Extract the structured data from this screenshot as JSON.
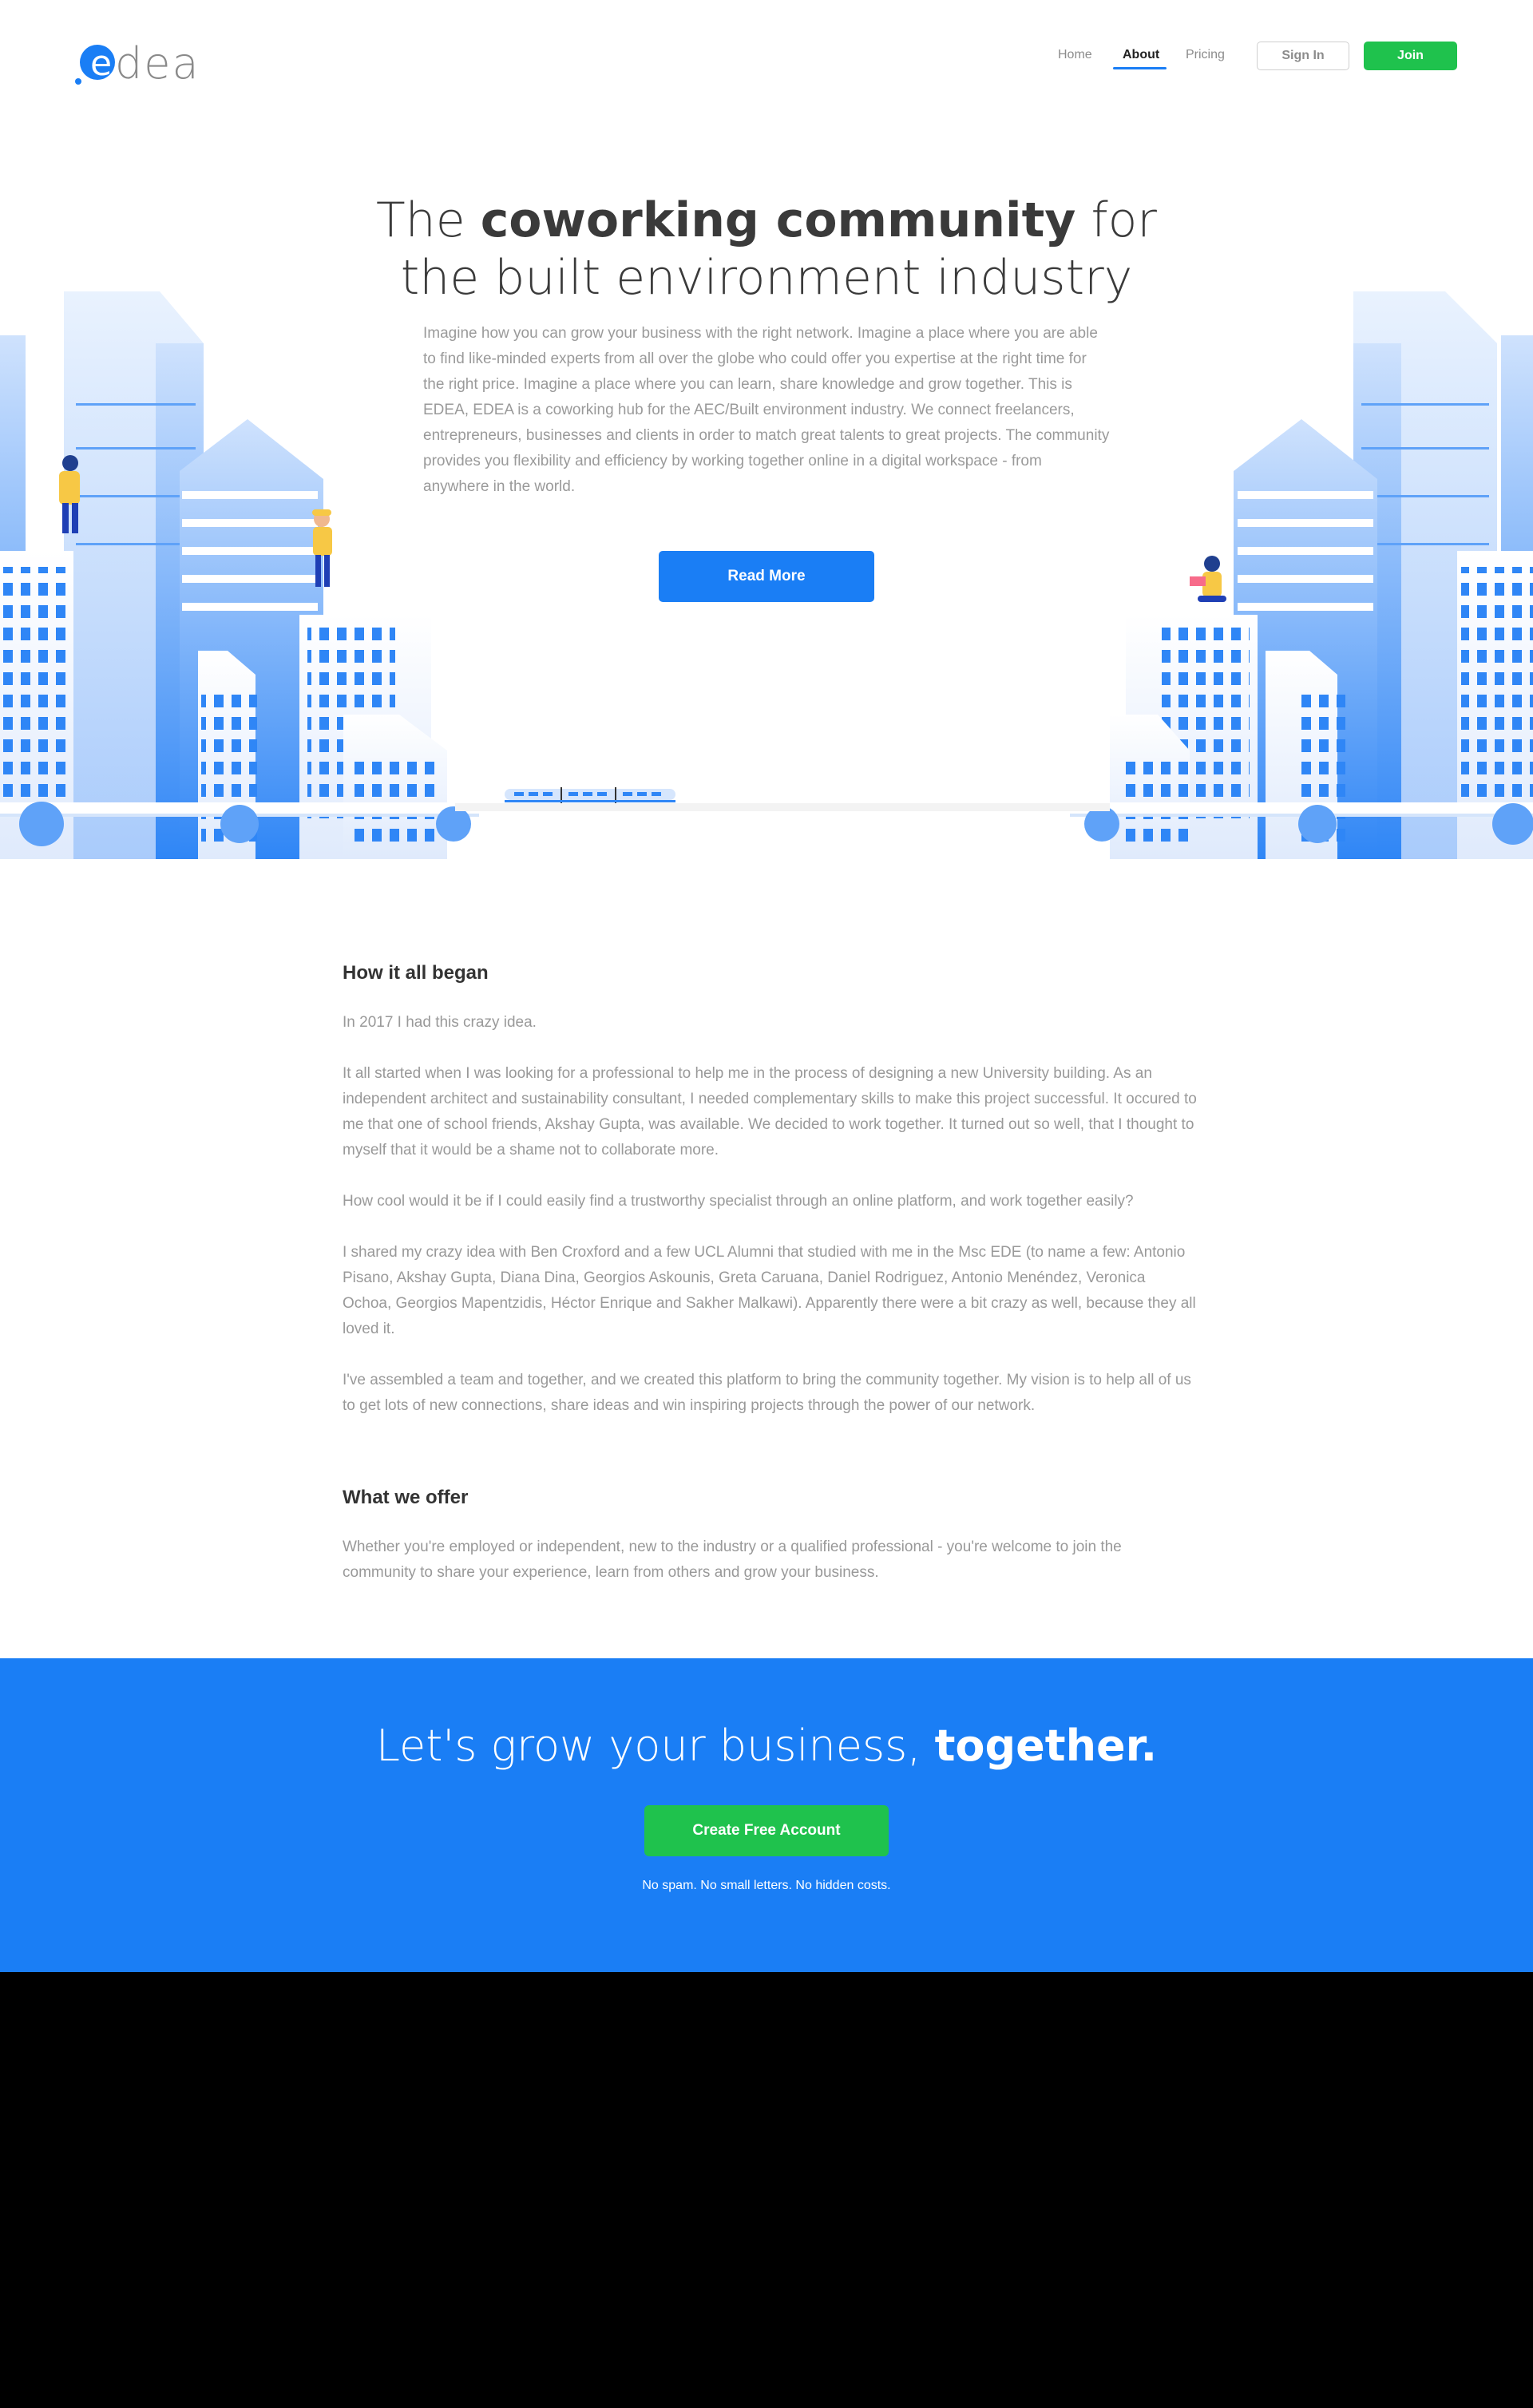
{
  "header": {
    "logo_text": "dea",
    "logo_letter": "e",
    "nav": {
      "home": "Home",
      "about": "About",
      "pricing": "Pricing"
    },
    "sign_in": "Sign In",
    "join": "Join"
  },
  "hero": {
    "title_part1": "The ",
    "title_bold": "coworking community",
    "title_part2": " for",
    "title_line2": "the built environment industry",
    "description": "Imagine how you can grow your business with the right network. Imagine a place where you are able to find like-minded experts from all over the globe who could offer you expertise at the right time for the right price. Imagine a place where you can learn, share knowledge and grow together. This is EDEA,  EDEA is a coworking hub for the AEC/Built environment industry. We connect freelancers, entrepreneurs, businesses and clients in order to match great talents to great projects. The community provides you flexibility and efficiency by working together online in a digital workspace - from anywhere in the world.",
    "read_more": "Read More"
  },
  "story": {
    "heading": "How it all began",
    "paragraphs": [
      "In 2017 I had this crazy idea.",
      "It all started when I was looking for a professional to help me in the process of designing a new University building. As an independent architect and sustainability consultant, I needed complementary skills to make this project successful. It occured to me that one of school friends, Akshay Gupta, was available. We decided to work together. It turned out so well, that I thought to myself that it would be a shame not to collaborate more.",
      "How cool would it be if I could easily find a trustworthy specialist through an online platform, and work together easily?",
      "I shared my crazy idea with Ben Croxford and a few UCL Alumni that studied with me in the Msc EDE (to name a few: Antonio Pisano, Akshay Gupta, Diana Dina, Georgios Askounis, Greta Caruana, Daniel Rodriguez, Antonio Menéndez, Veronica Ochoa, Georgios Mapentzidis, Héctor Enrique and Sakher Malkawi). Apparently there were a bit crazy as well, because they all loved it.",
      "I've assembled a team and together, and we created this platform to bring the community together. My vision is to help all of us to get lots of new connections, share ideas and win inspiring projects through the power of our network."
    ]
  },
  "offer": {
    "heading": "What we offer",
    "text": "Whether you're employed or independent, new to the industry or a qualified professional  - you're welcome to join the community to share your experience, learn from others and grow your business."
  },
  "cta": {
    "title_part1": "Let's grow your business, ",
    "title_bold": "together.",
    "button": "Create Free Account",
    "note": "No spam. No small letters. No hidden costs."
  },
  "colors": {
    "brand_blue": "#1a7ef5",
    "join_green": "#1fc24d",
    "text_gray": "#999999",
    "heading_dark": "#333333"
  }
}
